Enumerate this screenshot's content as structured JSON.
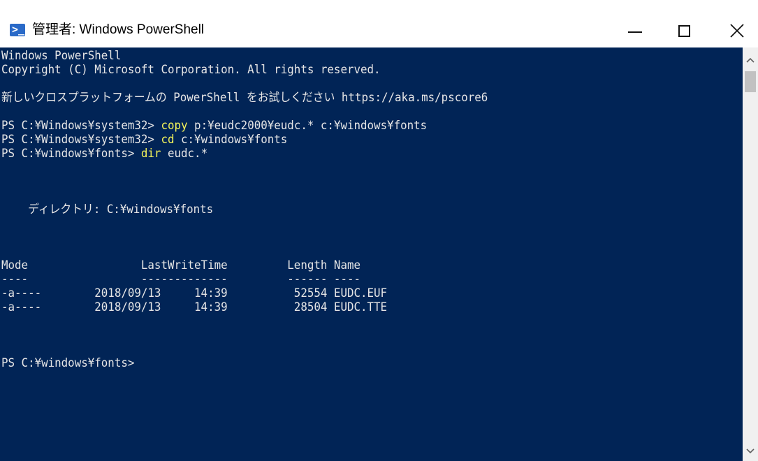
{
  "window": {
    "title": "管理者: Windows PowerShell",
    "icon": "powershell-icon",
    "controls": {
      "minimize": "minimize-icon",
      "maximize": "maximize-icon",
      "close": "close-icon"
    }
  },
  "console": {
    "background": "#012456",
    "text_color": "#e6e6e6",
    "command_color": "#f5f55a",
    "banner": [
      "Windows PowerShell",
      "Copyright (C) Microsoft Corporation. All rights reserved.",
      "新しいクロスプラットフォームの PowerShell をお試しください https://aka.ms/pscore6"
    ],
    "commands": [
      {
        "prompt": "PS C:¥Windows¥system32> ",
        "cmd": "copy",
        "args": " p:¥eudc2000¥eudc.* c:¥windows¥fonts"
      },
      {
        "prompt": "PS C:¥Windows¥system32> ",
        "cmd": "cd",
        "args": " c:¥windows¥fonts"
      },
      {
        "prompt": "PS C:¥windows¥fonts> ",
        "cmd": "dir",
        "args": " eudc.*"
      }
    ],
    "directory_line": "    ディレクトリ: C:¥windows¥fonts",
    "table": {
      "header": "Mode                 LastWriteTime         Length Name",
      "separator": "----                 -------------         ------ ----",
      "rows": [
        "-a----        2018/09/13     14:39          52554 EUDC.EUF",
        "-a----        2018/09/13     14:39          28504 EUDC.TTE"
      ]
    },
    "final_prompt": "PS C:¥windows¥fonts>"
  }
}
